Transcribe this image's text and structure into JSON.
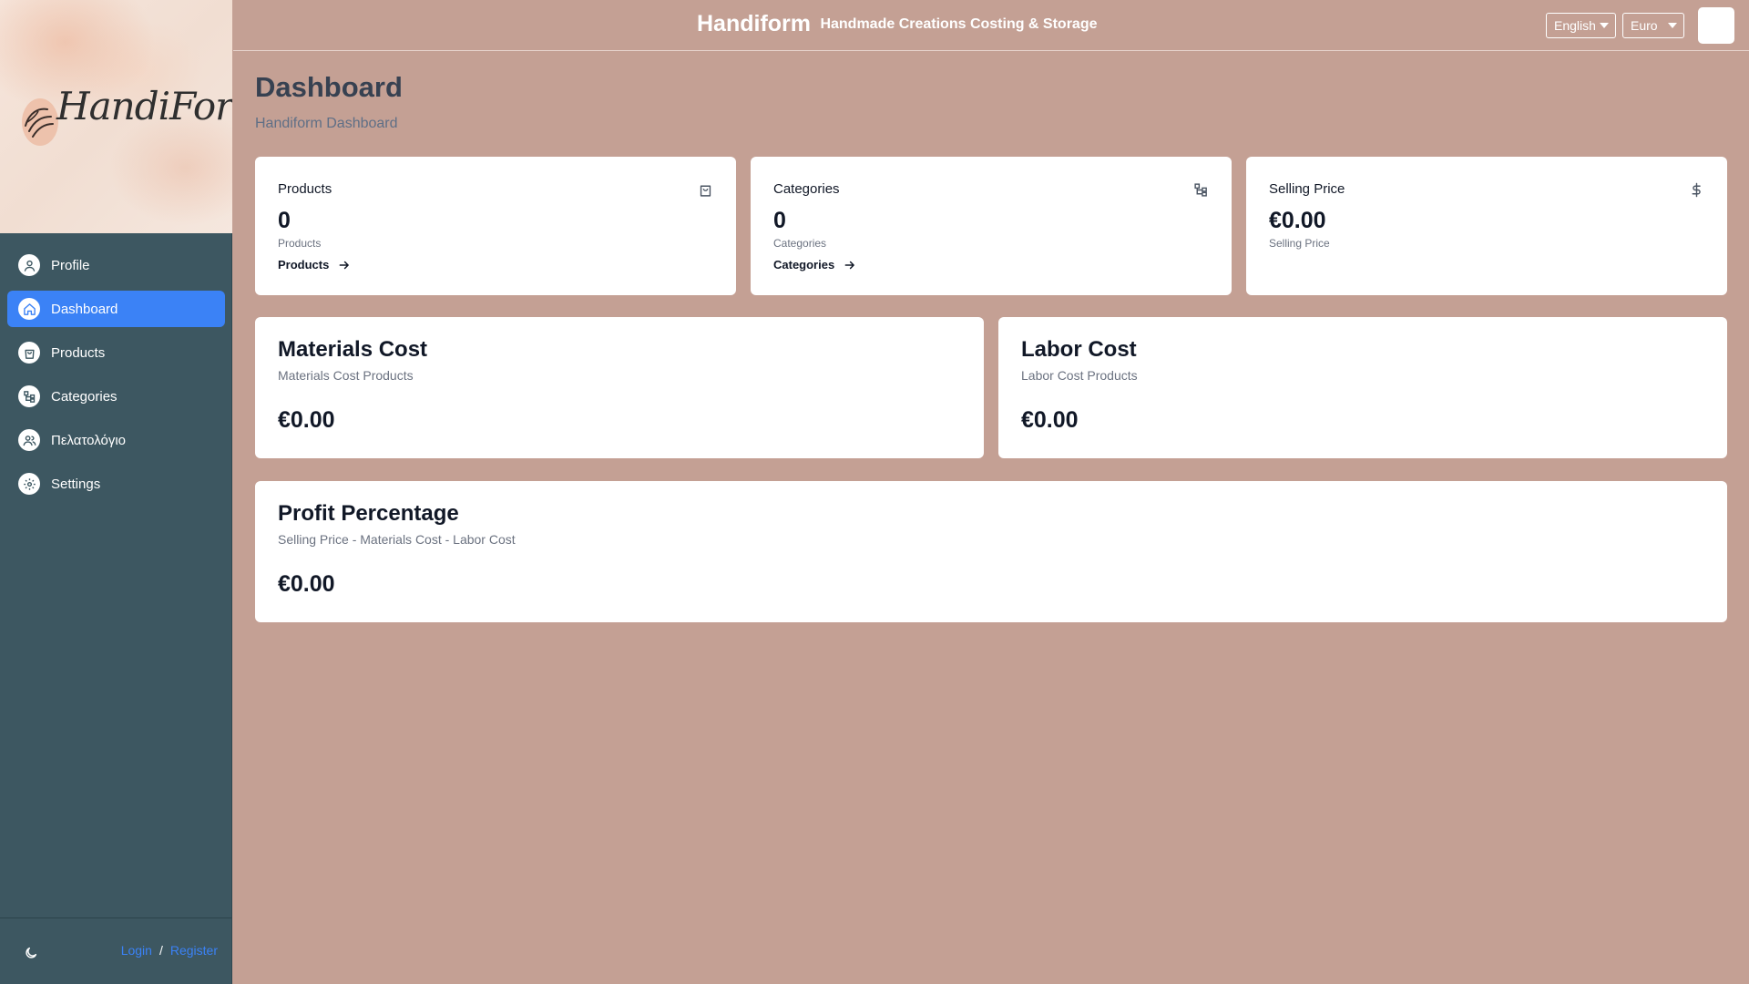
{
  "app": {
    "logo_text": "HandiForm",
    "title": "Handiform",
    "tagline": "Handmade Creations Costing & Storage"
  },
  "header": {
    "language": "English",
    "currency": "Euro"
  },
  "sidebar": {
    "items": [
      {
        "label": "Profile",
        "icon": "user-icon",
        "active": false
      },
      {
        "label": "Dashboard",
        "icon": "home-icon",
        "active": true
      },
      {
        "label": "Products",
        "icon": "shopping-bag-icon",
        "active": false
      },
      {
        "label": "Categories",
        "icon": "category-tree-icon",
        "active": false
      },
      {
        "label": "Πελατολόγιο",
        "icon": "users-icon",
        "active": false
      },
      {
        "label": "Settings",
        "icon": "gear-icon",
        "active": false
      }
    ],
    "footer": {
      "login": "Login",
      "separator": "/",
      "register": "Register"
    }
  },
  "page": {
    "title": "Dashboard",
    "subtitle": "Handiform Dashboard"
  },
  "stats": [
    {
      "label": "Products",
      "value": "0",
      "sub": "Products",
      "link": "Products",
      "icon": "shopping-bag-icon"
    },
    {
      "label": "Categories",
      "value": "0",
      "sub": "Categories",
      "link": "Categories",
      "icon": "category-tree-icon"
    },
    {
      "label": "Selling Price",
      "value": "€0.00",
      "sub": "Selling Price",
      "icon": "dollar-icon"
    }
  ],
  "costs": [
    {
      "title": "Materials Cost",
      "subtitle": "Materials Cost Products",
      "value": "€0.00"
    },
    {
      "title": "Labor Cost",
      "subtitle": "Labor Cost Products",
      "value": "€0.00"
    }
  ],
  "profit": {
    "title": "Profit Percentage",
    "subtitle": "Selling Price - Materials Cost - Labor Cost",
    "value": "€0.00"
  },
  "colors": {
    "background": "#c4a094",
    "sidebar": "#3d5761",
    "accent": "#3b82f6",
    "card": "#ffffff"
  }
}
